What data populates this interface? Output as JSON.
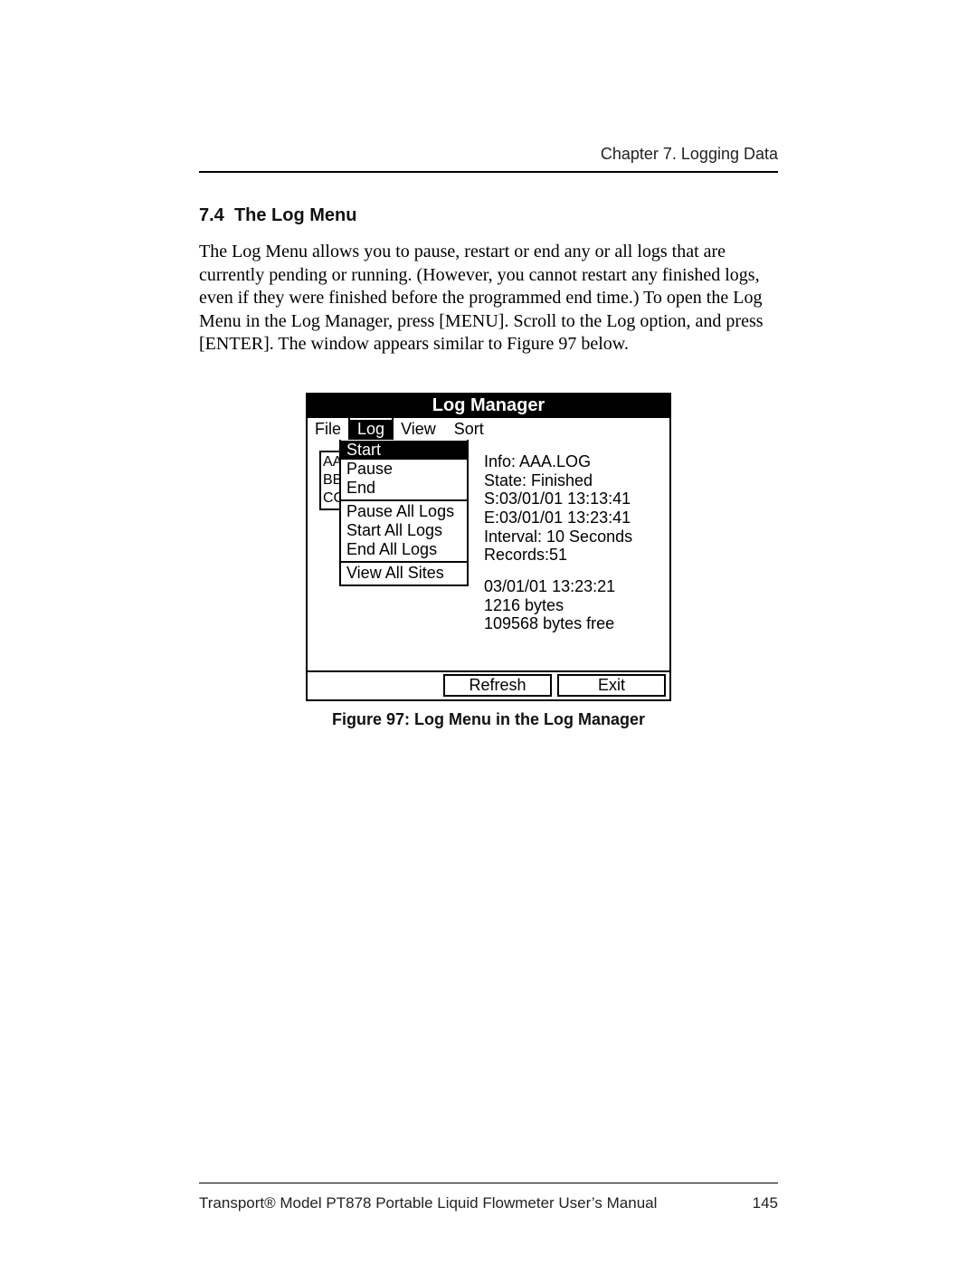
{
  "header": {
    "chapter": "Chapter 7. Logging Data"
  },
  "section": {
    "number": "7.4",
    "title": "The Log Menu"
  },
  "body": "The Log Menu allows you to pause, restart or end any or all logs that are currently pending or running. (However, you cannot restart any finished logs, even if they were finished before the programmed end time.) To open the Log Menu in the Log Manager, press [MENU]. Scroll to the Log option, and press [ENTER]. The window appears similar to Figure 97 below.",
  "device": {
    "title": "Log Manager",
    "menubar": {
      "file": "File",
      "log": "Log",
      "view": "View",
      "sort": "Sort"
    },
    "loglist": {
      "items": [
        "AA",
        "BB",
        "CC"
      ]
    },
    "dropdown": {
      "group1": {
        "start": "Start",
        "pause": "Pause",
        "end": "End"
      },
      "group2": {
        "pause_all": "Pause All Logs",
        "start_all": "Start All Logs",
        "end_all": "End All Logs"
      },
      "group3": {
        "view_all_sites": "View All Sites"
      }
    },
    "info": {
      "line1": "Info: AAA.LOG",
      "line2": "State: Finished",
      "line3": "S:03/01/01 13:13:41",
      "line4": "E:03/01/01 13:23:41",
      "line5": "Interval: 10 Seconds",
      "line6": "Records:51",
      "line7": "03/01/01 13:23:21",
      "line8": "1216 bytes",
      "line9": "109568 bytes free"
    },
    "buttons": {
      "refresh": "Refresh",
      "exit": "Exit"
    }
  },
  "figure_caption": "Figure 97: Log Menu in the Log Manager",
  "footer": {
    "left": "Transport® Model PT878 Portable Liquid Flowmeter User’s Manual",
    "right": "145"
  }
}
